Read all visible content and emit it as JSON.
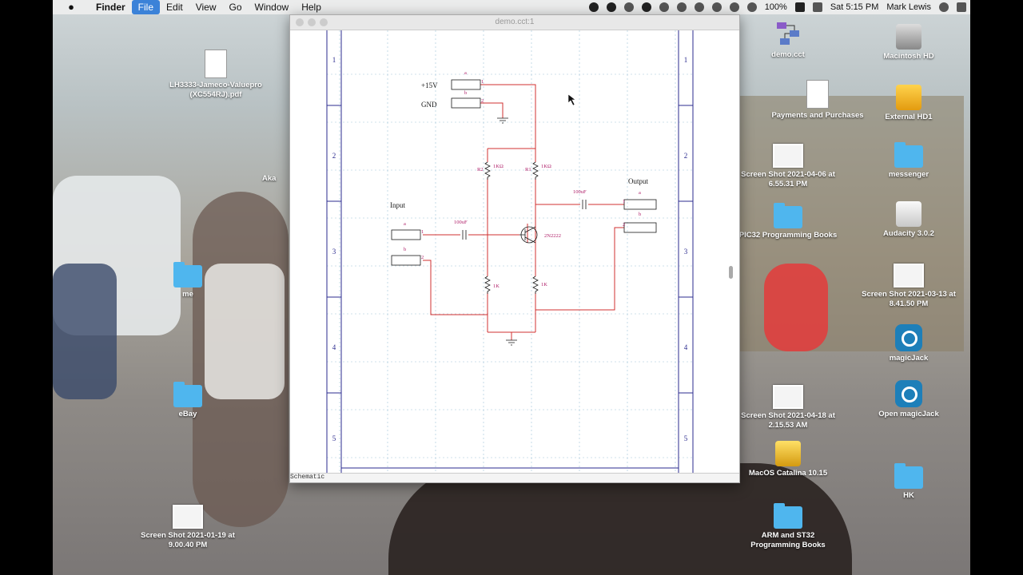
{
  "menubar": {
    "apple_icon": "apple-icon",
    "items": [
      "Finder",
      "File",
      "Edit",
      "View",
      "Go",
      "Window",
      "Help"
    ],
    "battery": "100%",
    "clock": "Sat 5:15 PM",
    "user": "Mark Lewis"
  },
  "desktop": {
    "left_icons": [
      {
        "label": "LH3333-Jameco-Valuepro (XC554RJ).pdf",
        "icon": "pdf-document-icon"
      },
      {
        "label": "Aka",
        "icon": ""
      },
      {
        "label": "me",
        "icon": "folder-icon"
      },
      {
        "label": "eBay",
        "icon": "folder-icon"
      },
      {
        "label": "Screen Shot 2021-01-19 at 9.00.40 PM",
        "icon": "screenshot-icon"
      }
    ],
    "right_icons": [
      {
        "label": "demo.cct",
        "icon": "circuit-file-icon"
      },
      {
        "label": "Macintosh HD",
        "icon": "hard-drive-icon"
      },
      {
        "label": "Payments and Purchases",
        "icon": "rtf-document-icon"
      },
      {
        "label": "External HD1",
        "icon": "external-drive-icon"
      },
      {
        "label": "Screen Shot 2021-04-06 at 6.55.31 PM",
        "icon": "screenshot-icon"
      },
      {
        "label": "messenger",
        "icon": "folder-icon"
      },
      {
        "label": "PIC32 Programming Books",
        "icon": "folder-icon"
      },
      {
        "label": "Audacity 3.0.2",
        "icon": "disk-image-icon"
      },
      {
        "label": "Screen Shot 2021-03-13 at 8.41.50 PM",
        "icon": "screenshot-icon"
      },
      {
        "label": "magicJack",
        "icon": "magicjack-icon"
      },
      {
        "label": "Screen Shot 2021-04-18 at 2.15.53 AM",
        "icon": "screenshot-icon"
      },
      {
        "label": "Open magicJack",
        "icon": "magicjack-icon"
      },
      {
        "label": "MacOS Catalina  10.15",
        "icon": "installer-drive-icon"
      },
      {
        "label": "HK",
        "icon": "folder-icon"
      },
      {
        "label": "ARM and ST32 Programming Books",
        "icon": "folder-icon"
      }
    ]
  },
  "window": {
    "title": "demo.cct:1",
    "status": "Schematic",
    "row_labels": [
      "1",
      "2",
      "3",
      "4",
      "5"
    ],
    "schematic": {
      "supply_label": "+15V",
      "gnd_label": "GND",
      "input_label": "Input",
      "output_label": "Output",
      "pin_a": "a",
      "pin_b": "b",
      "pin_1": "1",
      "pin_2": "2",
      "r2_ref": "R2",
      "r1_ref": "R1",
      "r_top_value": "1KΩ",
      "r_bottom_value": "1K",
      "cap_value": "100uF",
      "transistor": "2N2222"
    }
  },
  "colors": {
    "wire": "#d23030",
    "part": "#1a1a1a",
    "label": "#b0206a",
    "grid": "#9fc3d8",
    "border": "#2b2b8f"
  }
}
